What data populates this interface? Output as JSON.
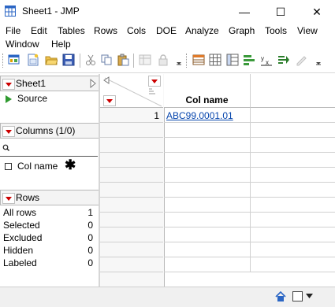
{
  "window": {
    "title": "Sheet1 - JMP",
    "minimize": "—",
    "maximize": "☐",
    "close": "✕"
  },
  "menu": {
    "items": [
      "File",
      "Edit",
      "Tables",
      "Rows",
      "Cols",
      "DOE",
      "Analyze",
      "Graph",
      "Tools",
      "View",
      "Window",
      "Help"
    ]
  },
  "table_panel": {
    "name": "Sheet1",
    "items": [
      "Source"
    ]
  },
  "columns_panel": {
    "header": "Columns (1/0)",
    "columns": [
      {
        "name": "Col name",
        "marker": "✱"
      }
    ]
  },
  "rows_panel": {
    "header": "Rows",
    "stats": [
      {
        "label": "All rows",
        "value": "1"
      },
      {
        "label": "Selected",
        "value": "0"
      },
      {
        "label": "Excluded",
        "value": "0"
      },
      {
        "label": "Hidden",
        "value": "0"
      },
      {
        "label": "Labeled",
        "value": "0"
      }
    ]
  },
  "grid": {
    "column_header": "Col name",
    "rows": [
      {
        "number": "1",
        "value": "ABC99.0001.01"
      }
    ]
  },
  "colors": {
    "accent": "#cc0000",
    "link": "#0645ad"
  }
}
